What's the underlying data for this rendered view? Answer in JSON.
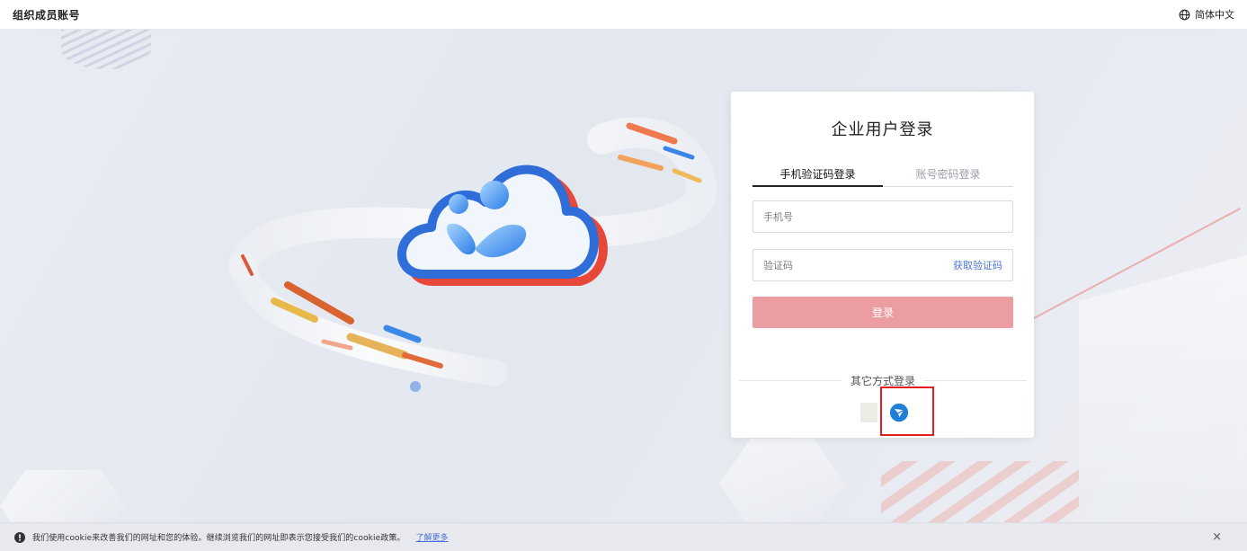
{
  "header": {
    "brand": "组织成员账号",
    "language_label": "简体中文",
    "language_icon": "globe-icon"
  },
  "login": {
    "title": "企业用户登录",
    "tabs": [
      {
        "label": "手机验证码登录",
        "active": true
      },
      {
        "label": "账号密码登录",
        "active": false
      }
    ],
    "phone_placeholder": "手机号",
    "code_placeholder": "验证码",
    "get_code_label": "获取验证码",
    "submit_label": "登录",
    "other_methods_label": "其它方式登录",
    "sso_icons": [
      "blank-provider-icon",
      "feishu-icon"
    ]
  },
  "cookie": {
    "text": "我们使用cookie来改善我们的网址和您的体验。继续浏览我们的网址即表示您接受我们的cookie政策。",
    "link_label": "了解更多",
    "close_label": "×",
    "icon": "info-icon"
  },
  "colors": {
    "primary_button": "#eb9da1",
    "link": "#4a76d6",
    "highlight": "#e11f1f"
  }
}
